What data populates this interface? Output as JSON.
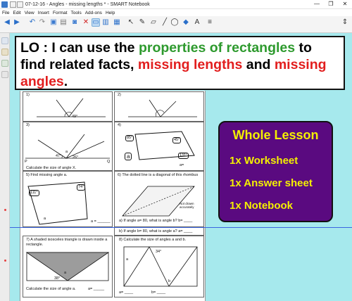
{
  "window": {
    "title": "07-12-16 - Angles - missing lengths * - SMART Notebook",
    "controls": [
      "—",
      "❐",
      "✕"
    ]
  },
  "menu": [
    "File",
    "Edit",
    "View",
    "Insert",
    "Format",
    "Tools",
    "Add-ons",
    "Help"
  ],
  "colors": {
    "canvas_bg": "#a6e9ed",
    "green": "#2e9a2e",
    "red": "#e21e1e",
    "purple_bg": "#5a0a80",
    "yellow_text": "#f4f000"
  },
  "lo": {
    "part1": "LO : I can use the ",
    "green": "properties of rectangles",
    "part2": " to find related facts, ",
    "red1": "missing lengths",
    "part3": " and ",
    "red2": "missing angles",
    "part4": "."
  },
  "lesson_box": {
    "title": "Whole Lesson",
    "items": [
      "1x Worksheet",
      "1x Answer sheet",
      "1x Notebook"
    ]
  },
  "worksheet": {
    "q1": "1)",
    "q1_angle": "49°",
    "q2": "2)",
    "q3": "3)",
    "q3_angles": [
      "47°",
      "26°"
    ],
    "q3_letter": "a",
    "q3_points": [
      "P",
      "Q"
    ],
    "q3_instruction": "Calculate the size of angle X.",
    "q4": "4)",
    "q4_angles": [
      "85°",
      "45°",
      "131°"
    ],
    "q4_letter": "a",
    "q4_answer": "a=",
    "q5": "5)   Find missing angle a.",
    "q5_angles": [
      "111°",
      "74°"
    ],
    "q5_letter": "a",
    "q5_answer": "a = ______",
    "q6": "6)   The dotted line is a diagonal of this rhombus",
    "q6_note": "Not drawn accurately",
    "q6a": "a)   If angle a= 80, what is angle b?  b= ____",
    "q6b": "b)   If angle b= 80, what is angle a?  a= ____",
    "q7": "7)   A shaded isosceles triangle is drawn inside a rectangle.",
    "q7_angle": "38°",
    "q7_letter": "a",
    "q7_instruction": "Calculate the size of angle a.",
    "q7_answer": "a= _____",
    "q8": "8)   Calculate the size of angles a and b.",
    "q8_angle": "34°",
    "q8_letters": [
      "a",
      "b"
    ],
    "q8_answer_a": "a= ____",
    "q8_answer_b": "b= ____"
  }
}
